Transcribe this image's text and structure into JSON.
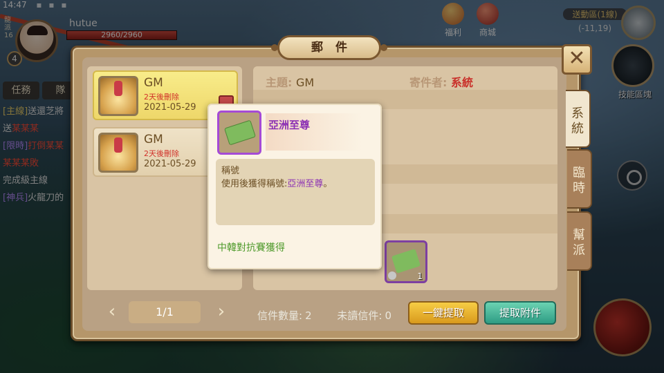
{
  "status_bar": {
    "time": "14:47"
  },
  "hud": {
    "server_tag": "龍派16",
    "level": "4",
    "player_name": "hutue",
    "hp_text": "2960/2960",
    "hp_fraction": 1.0
  },
  "top_right": {
    "welfare_label": "福利",
    "shop_label": "商城",
    "map_name": "送動區(1線)",
    "coords": "(-11,19)"
  },
  "skills": {
    "skill_label": "技能區塊"
  },
  "quest": {
    "tabs": [
      "任務",
      "隊"
    ],
    "lines": [
      {
        "tag": "[主線]",
        "text": "送還芝將"
      },
      {
        "tag": "",
        "text": "送",
        "red": "某某某"
      },
      {
        "tag": "[限時]",
        "text": "",
        "red": "打倒某某"
      },
      {
        "tag": "",
        "text": "",
        "red": "某某某敗"
      },
      {
        "tag": "",
        "text": "完成",
        "red": "",
        "extra": "級主線"
      },
      {
        "tag": "[神兵]",
        "text": "火龍刀的"
      }
    ]
  },
  "mail": {
    "title": "郵件",
    "items": [
      {
        "sender": "GM",
        "expire": "2天後刪除",
        "date": "2021-05-29",
        "selected": true
      },
      {
        "sender": "GM",
        "expire": "2天後刪除",
        "date": "2021-05-29",
        "selected": false
      }
    ],
    "pager": {
      "text": "1/1"
    },
    "detail": {
      "subject_label": "主題:",
      "subject_value": "GM",
      "sender_label": "寄件者:",
      "sender_value": "系統",
      "attachment_qty": "1"
    },
    "counts": {
      "mail_count_label": "信件數量:",
      "mail_count": "2",
      "unread_label": "未讀信件:",
      "unread_count": "0"
    },
    "buttons": {
      "collect_all": "一鍵提取",
      "collect_attachment": "提取附件"
    },
    "side_tabs": [
      {
        "label": "系統",
        "active": true
      },
      {
        "label": "臨時",
        "active": false
      },
      {
        "label": "幫派",
        "active": false
      }
    ]
  },
  "tooltip": {
    "item_name": "亞洲至尊",
    "type": "稱號",
    "desc_prefix": "使用後獲得稱號:",
    "desc_highlight": "亞洲至尊",
    "desc_suffix": "。",
    "source": "中韓對抗賽獲得"
  },
  "colors": {
    "rarity_purple": "#8b2fb4",
    "expire_red": "#d1312a",
    "source_green": "#4e9a2b"
  }
}
